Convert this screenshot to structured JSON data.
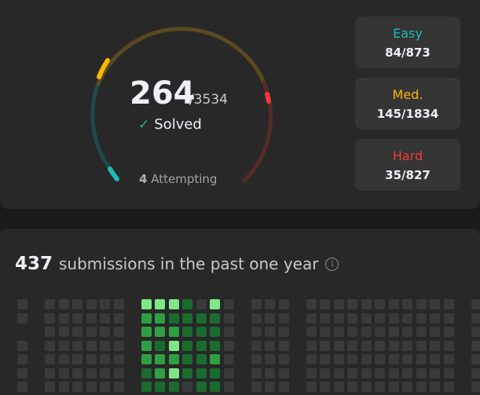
{
  "progress": {
    "solved": "264",
    "total": "/3534",
    "solved_label": "Solved",
    "attempting_count": "4",
    "attempting_label": "Attempting",
    "colors": {
      "easy": "#1cbaba",
      "medium": "#ffb700",
      "hard": "#f63737"
    }
  },
  "difficulties": [
    {
      "name": "Easy",
      "value": "84/873",
      "color": "#1cbaba"
    },
    {
      "name": "Med.",
      "value": "145/1834",
      "color": "#ffb700"
    },
    {
      "name": "Hard",
      "value": "35/827",
      "color": "#f63737"
    }
  ],
  "submissions": {
    "count": "437",
    "label": "submissions in the past one year",
    "info_icon": "info-icon"
  },
  "heatmap": {
    "levels": [
      "#3a3a3a",
      "#0e4429",
      "#196c2e",
      "#2ea043",
      "#7ee787"
    ]
  }
}
